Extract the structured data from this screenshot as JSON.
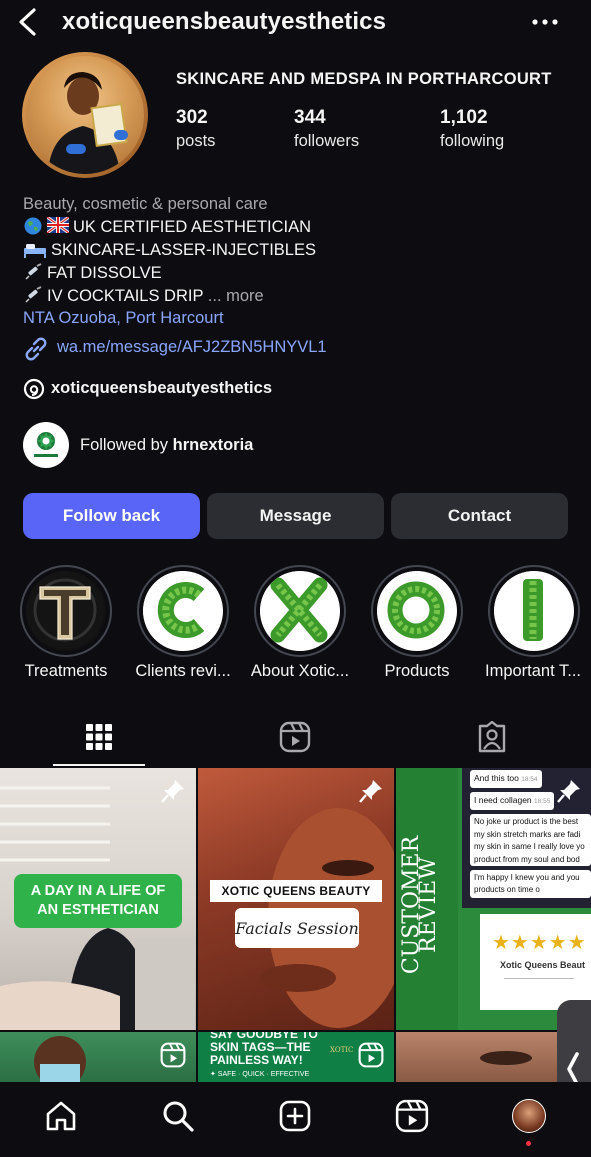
{
  "header": {
    "username": "xoticqueensbeautyesthetics",
    "back_icon": "chevron-left-icon",
    "more_icon": "more-horizontal-icon"
  },
  "profile": {
    "display_name": "SKINCARE AND MEDSPA IN PORTHARCOURT",
    "stats": [
      {
        "value": "302",
        "label": "posts"
      },
      {
        "value": "344",
        "label": "followers"
      },
      {
        "value": "1,102",
        "label": "following"
      }
    ]
  },
  "bio": {
    "category": "Beauty, cosmetic & personal care",
    "lines": [
      {
        "icon": "globe-emoji",
        "flag": "uk-flag-emoji",
        "text": "UK CERTIFIED AESTHETICIAN"
      },
      {
        "icon": "bed-emoji",
        "text": "SKINCARE-LASSER-INJECTIBLES"
      },
      {
        "icon": "syringe-emoji",
        "text": "FAT DISSOLVE"
      },
      {
        "icon": "syringe-emoji",
        "text": "IV COCKTAILS DRIP"
      }
    ],
    "more_prefix": " ... ",
    "more_label": "more",
    "location": "NTA Ozuoba, Port Harcourt",
    "link": "wa.me/message/AFJ2ZBN5HNYVL1",
    "threads_handle": "xoticqueensbeautyesthetics",
    "followed_by_prefix": "Followed by ",
    "followed_by_name": "hrnextoria"
  },
  "buttons": {
    "follow_back": "Follow back",
    "message": "Message",
    "contact": "Contact"
  },
  "highlights": [
    {
      "label": "Treatments"
    },
    {
      "label": "Clients revi..."
    },
    {
      "label": "About Xotic..."
    },
    {
      "label": "Products"
    },
    {
      "label": "Important T..."
    }
  ],
  "tabs": [
    {
      "name": "posts-grid",
      "icon": "grid-icon",
      "active": true
    },
    {
      "name": "reels",
      "icon": "reels-icon",
      "active": false
    },
    {
      "name": "tagged",
      "icon": "tagged-person-icon",
      "active": false
    }
  ],
  "posts": [
    {
      "caption_line1": "A DAY IN A LIFE OF",
      "caption_line2": "AN ESTHETICIAN",
      "pinned": true
    },
    {
      "title": "XOTIC QUEENS BEAUTY",
      "subtitle": "Facials Session",
      "pinned": true
    },
    {
      "vertical_title_1": "CUSTOMER",
      "vertical_title_2": "REVIEW",
      "chat": [
        {
          "text": "And this too",
          "time": "18:54"
        },
        {
          "text": "I need collagen",
          "time": "18:55"
        },
        {
          "text": "No joke ur product is the best my skin stretch marks are fadi my skin in same I really love yo product from my soul and bod"
        },
        {
          "text": "I'm happy I knew you and you products on time o"
        }
      ],
      "stars": "★★★★★",
      "brand": "Xotic Queens Beaut",
      "pinned": true
    },
    {
      "type": "reel"
    },
    {
      "line1": "SAY GOODBYE TO",
      "line2": "SKIN TAGS—THE",
      "line3": "PAINLESS WAY!",
      "footer": "✦ SAFE · QUICK · EFFECTIVE",
      "brand": "XOTIC",
      "type": "reel"
    },
    {
      "type": "photo"
    }
  ],
  "bottom_nav": [
    {
      "name": "home",
      "icon": "home-icon"
    },
    {
      "name": "search",
      "icon": "search-icon"
    },
    {
      "name": "create",
      "icon": "plus-square-icon"
    },
    {
      "name": "reels",
      "icon": "reels-icon"
    },
    {
      "name": "profile",
      "icon": "profile-avatar-icon"
    }
  ],
  "colors": {
    "background": "#0c0c11",
    "accent": "#5865f7",
    "link": "#8aa6ff",
    "button_secondary": "#2b2d33"
  }
}
